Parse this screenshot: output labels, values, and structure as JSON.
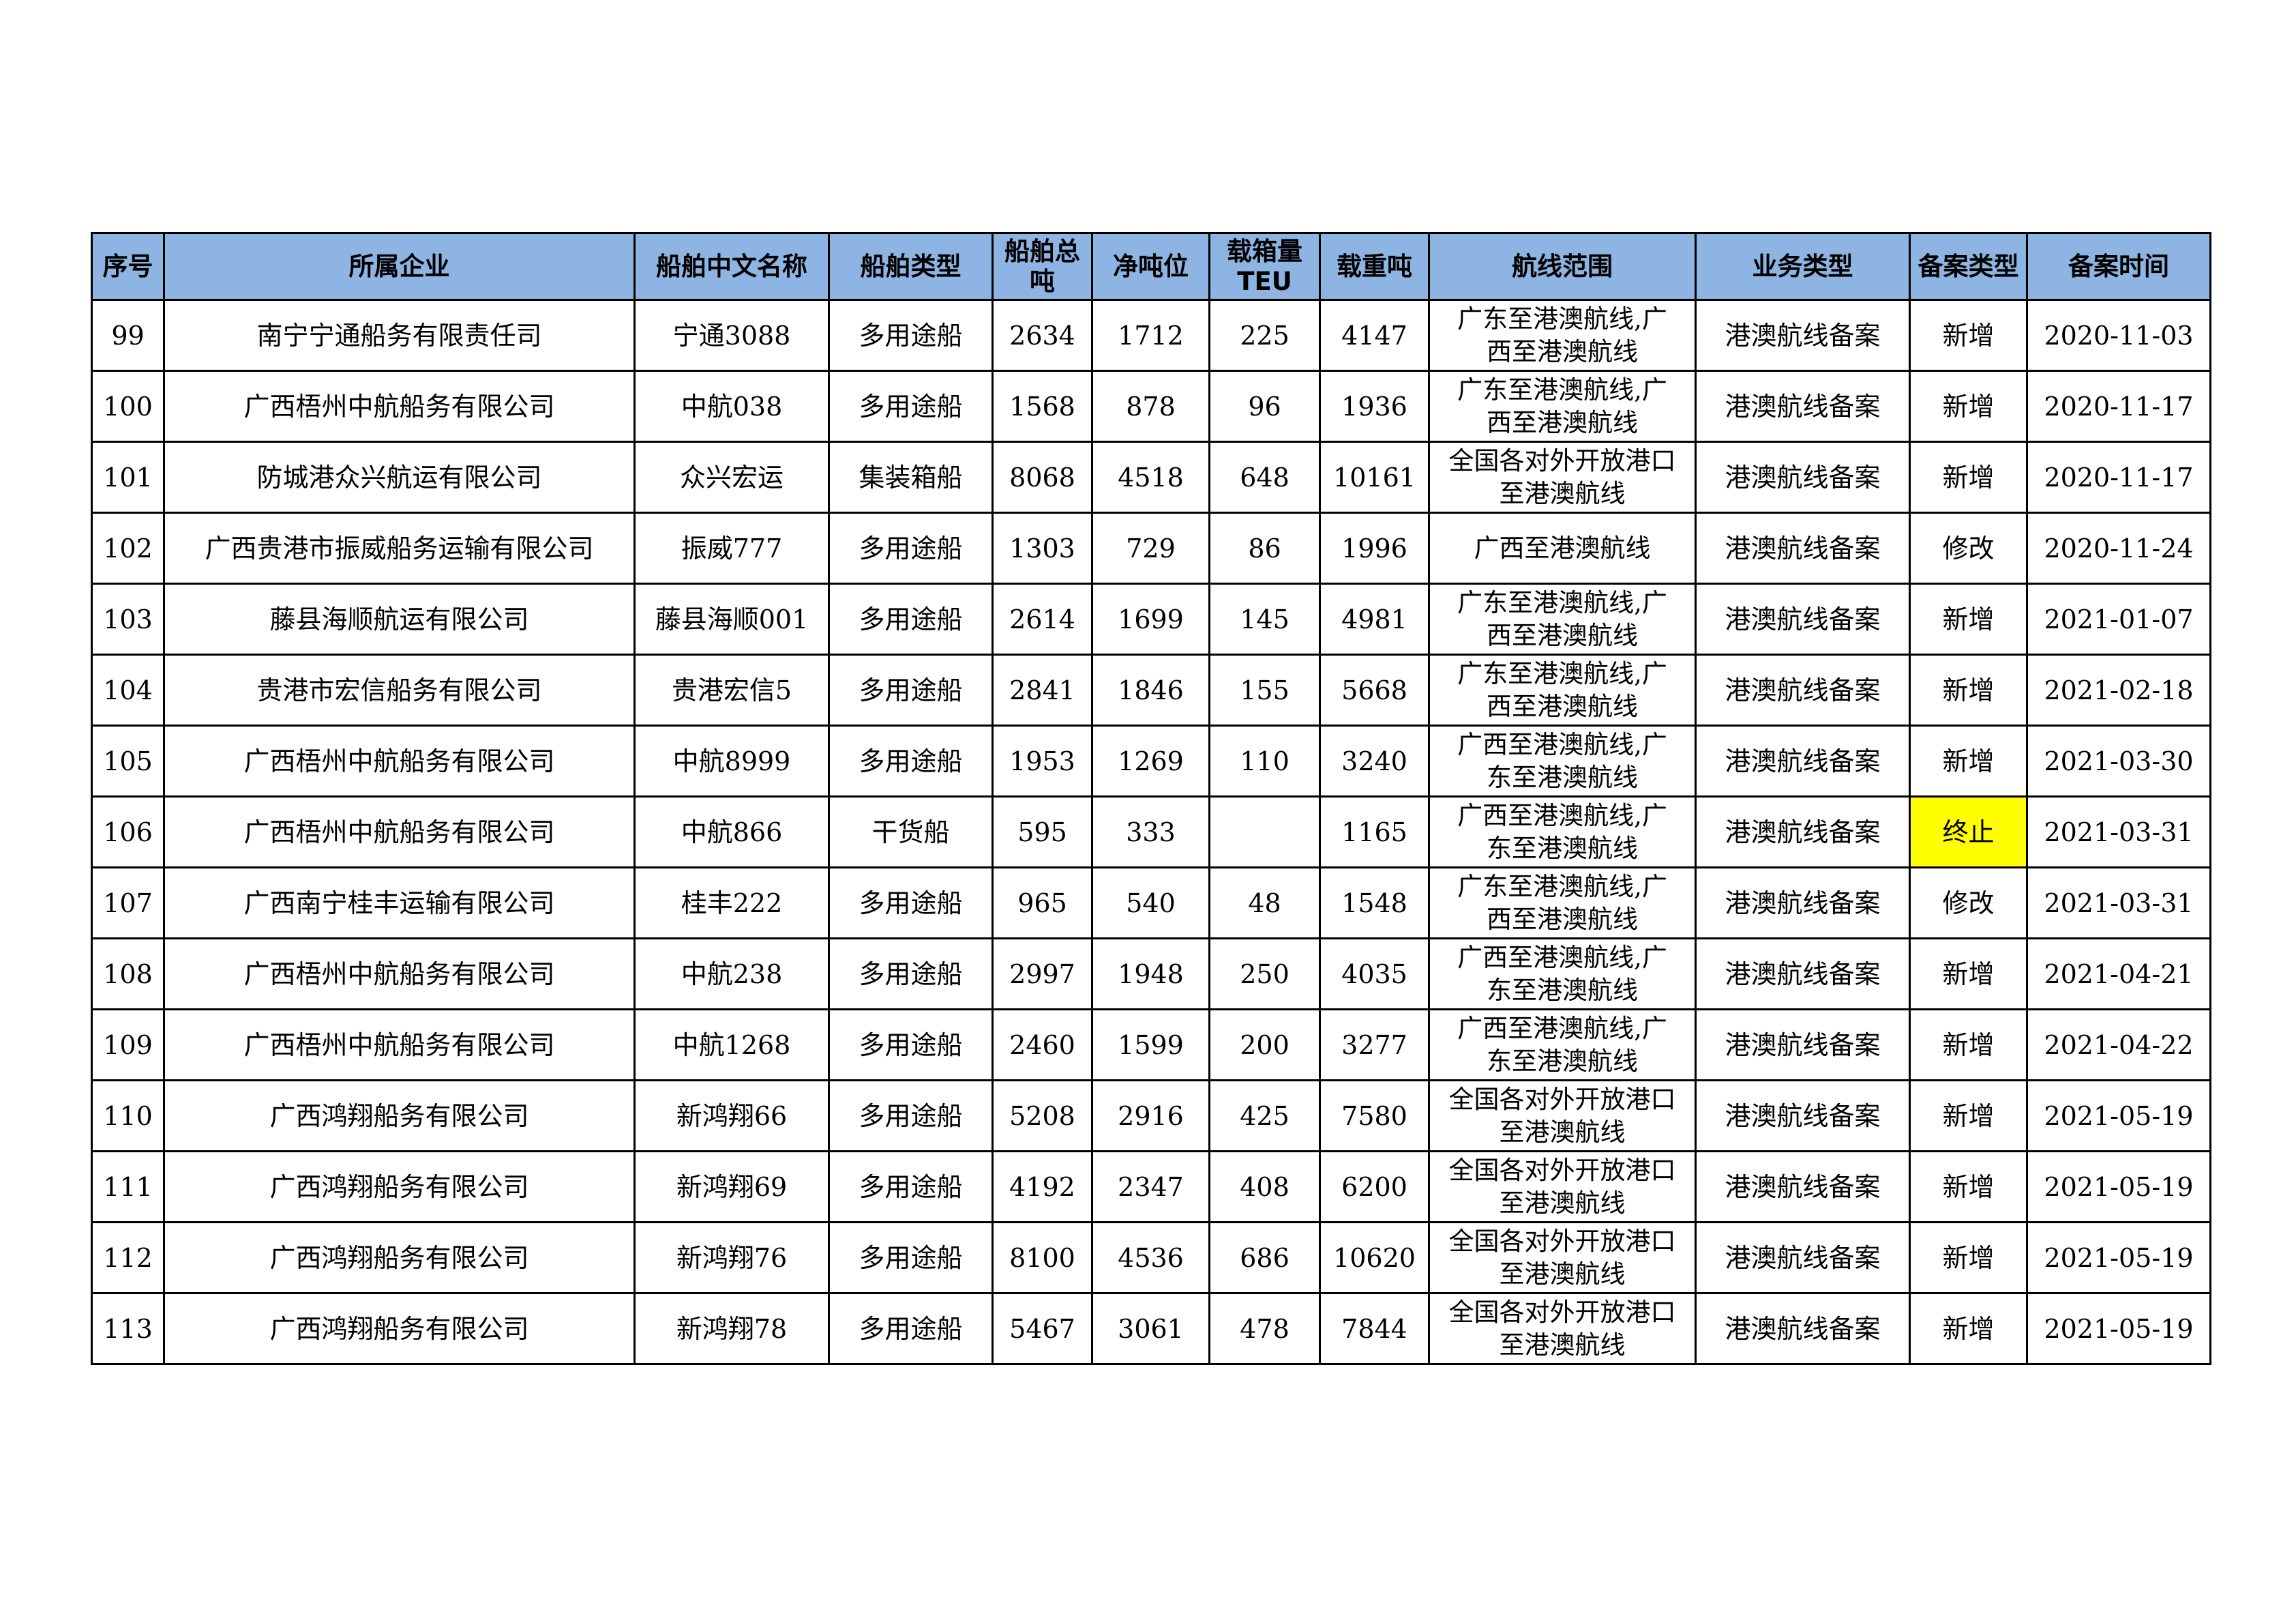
{
  "table": {
    "headers": [
      "序号",
      "所属企业",
      "船舶中文名称",
      "船舶类型",
      "船舶总\n吨",
      "净吨位",
      "载箱量\nTEU",
      "载重吨",
      "航线范围",
      "业务类型",
      "备案类型",
      "备案时间"
    ],
    "rows": [
      [
        "99",
        "南宁宁通船务有限责任司",
        "宁通3088",
        "多用途船",
        "2634",
        "1712",
        "225",
        "4147",
        "广东至港澳航线,广\n西至港澳航线",
        "港澳航线备案",
        "新增",
        "2020-11-03"
      ],
      [
        "100",
        "广西梧州中航船务有限公司",
        "中航038",
        "多用途船",
        "1568",
        "878",
        "96",
        "1936",
        "广东至港澳航线,广\n西至港澳航线",
        "港澳航线备案",
        "新增",
        "2020-11-17"
      ],
      [
        "101",
        "防城港众兴航运有限公司",
        "众兴宏运",
        "集装箱船",
        "8068",
        "4518",
        "648",
        "10161",
        "全国各对外开放港口\n至港澳航线",
        "港澳航线备案",
        "新增",
        "2020-11-17"
      ],
      [
        "102",
        "广西贵港市振威船务运输有限公司",
        "振威777",
        "多用途船",
        "1303",
        "729",
        "86",
        "1996",
        "广西至港澳航线",
        "港澳航线备案",
        "修改",
        "2020-11-24"
      ],
      [
        "103",
        "藤县海顺航运有限公司",
        "藤县海顺001",
        "多用途船",
        "2614",
        "1699",
        "145",
        "4981",
        "广东至港澳航线,广\n西至港澳航线",
        "港澳航线备案",
        "新增",
        "2021-01-07"
      ],
      [
        "104",
        "贵港市宏信船务有限公司",
        "贵港宏信5",
        "多用途船",
        "2841",
        "1846",
        "155",
        "5668",
        "广东至港澳航线,广\n西至港澳航线",
        "港澳航线备案",
        "新增",
        "2021-02-18"
      ],
      [
        "105",
        "广西梧州中航船务有限公司",
        "中航8999",
        "多用途船",
        "1953",
        "1269",
        "110",
        "3240",
        "广西至港澳航线,广\n东至港澳航线",
        "港澳航线备案",
        "新增",
        "2021-03-30"
      ],
      [
        "106",
        "广西梧州中航船务有限公司",
        "中航866",
        "干货船",
        "595",
        "333",
        "",
        "1165",
        "广西至港澳航线,广\n东至港澳航线",
        "港澳航线备案",
        "终止",
        "2021-03-31"
      ],
      [
        "107",
        "广西南宁桂丰运输有限公司",
        "桂丰222",
        "多用途船",
        "965",
        "540",
        "48",
        "1548",
        "广东至港澳航线,广\n西至港澳航线",
        "港澳航线备案",
        "修改",
        "2021-03-31"
      ],
      [
        "108",
        "广西梧州中航船务有限公司",
        "中航238",
        "多用途船",
        "2997",
        "1948",
        "250",
        "4035",
        "广西至港澳航线,广\n东至港澳航线",
        "港澳航线备案",
        "新增",
        "2021-04-21"
      ],
      [
        "109",
        "广西梧州中航船务有限公司",
        "中航1268",
        "多用途船",
        "2460",
        "1599",
        "200",
        "3277",
        "广西至港澳航线,广\n东至港澳航线",
        "港澳航线备案",
        "新增",
        "2021-04-22"
      ],
      [
        "110",
        "广西鸿翔船务有限公司",
        "新鸿翔66",
        "多用途船",
        "5208",
        "2916",
        "425",
        "7580",
        "全国各对外开放港口\n至港澳航线",
        "港澳航线备案",
        "新增",
        "2021-05-19"
      ],
      [
        "111",
        "广西鸿翔船务有限公司",
        "新鸿翔69",
        "多用途船",
        "4192",
        "2347",
        "408",
        "6200",
        "全国各对外开放港口\n至港澳航线",
        "港澳航线备案",
        "新增",
        "2021-05-19"
      ],
      [
        "112",
        "广西鸿翔船务有限公司",
        "新鸿翔76",
        "多用途船",
        "8100",
        "4536",
        "686",
        "10620",
        "全国各对外开放港口\n至港澳航线",
        "港澳航线备案",
        "新增",
        "2021-05-19"
      ],
      [
        "113",
        "广西鸿翔船务有限公司",
        "新鸿翔78",
        "多用途船",
        "5467",
        "3061",
        "478",
        "7844",
        "全国各对外开放港口\n至港澳航线",
        "港澳航线备案",
        "新增",
        "2021-05-19"
      ]
    ],
    "highlighted_cell": {
      "row": 7,
      "col": 10,
      "color": "#ffff00"
    },
    "header_color": "#8db4e2"
  }
}
